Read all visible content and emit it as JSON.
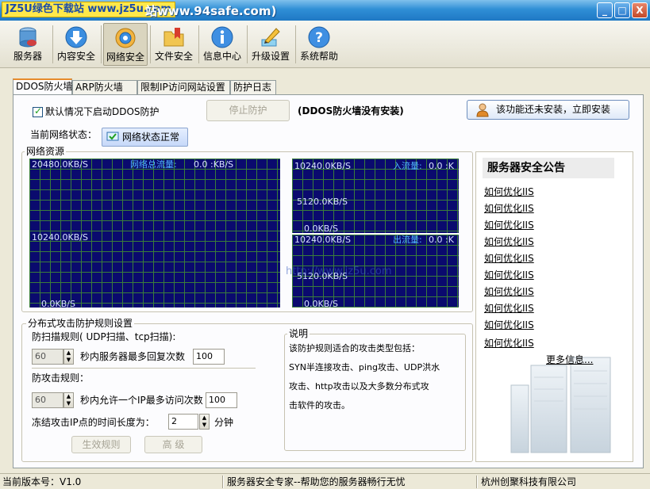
{
  "window": {
    "watermark": "JZ5U绿色下载站 www.jz5u.com",
    "title_fragment": "站www.94safe.com)",
    "controls": [
      "_",
      "□",
      "X"
    ]
  },
  "toolbar": {
    "items": [
      {
        "label": "服务器",
        "icon": "server-icon"
      },
      {
        "label": "内容安全",
        "icon": "download-arrow-icon"
      },
      {
        "label": "网络安全",
        "icon": "globe-gear-icon"
      },
      {
        "label": "文件安全",
        "icon": "folder-bookmark-icon"
      },
      {
        "label": "信息中心",
        "icon": "info-icon"
      },
      {
        "label": "升级设置",
        "icon": "pencil-icon"
      },
      {
        "label": "系统帮助",
        "icon": "help-icon"
      }
    ],
    "active_index": 2
  },
  "tabs": [
    {
      "label": "DDOS防火墙"
    },
    {
      "label": "ARP防火墙"
    },
    {
      "label": "限制IP访问网站设置"
    },
    {
      "label": "防护日志"
    }
  ],
  "ddos": {
    "checkbox_label": "默认情况下启动DDOS防护",
    "checkbox_checked": true,
    "stop_button": "停止防护",
    "not_installed_text": "(DDOS防火墙没有安装)",
    "install_button": "该功能还未安装，立即安装",
    "current_status_label": "当前网络状态：",
    "current_status_value": "网络状态正常"
  },
  "network": {
    "group_label": "网络资源",
    "total_graph": {
      "top": "20480.0KB/S",
      "mid": "10240.0KB/S",
      "bottom": "0.0KB/S",
      "caption": "网络总流量:",
      "value": "0.0 :KB/S"
    },
    "in_graph": {
      "top": "10240.0KB/S",
      "mid": "5120.0KB/S",
      "bottom": "0.0KB/S",
      "caption": "入流量:",
      "value": "0.0 :K"
    },
    "out_graph": {
      "top": "10240.0KB/S",
      "mid": "5120.0KB/S",
      "bottom": "0.0KB/S",
      "caption": "出流量:",
      "value": "0.0 :K"
    },
    "overlay_watermark": "http://www.jz5u.com"
  },
  "notice": {
    "title": "服务器安全公告",
    "links": [
      "如何优化IIS",
      "如何优化IIS",
      "如何优化IIS",
      "如何优化IIS",
      "如何优化IIS",
      "如何优化IIS",
      "如何优化IIS",
      "如何优化IIS",
      "如何优化IIS",
      "如何优化IIS"
    ],
    "more": "更多信息..."
  },
  "rules": {
    "group_label": "分布式攻击防护规则设置",
    "scan_rule_label": "防扫描规则( UDP扫描、tcp扫描):",
    "scan_seconds": "60",
    "scan_text": "秒内服务器最多回复次数",
    "scan_count": "100",
    "attack_rule_label": "防攻击规则：",
    "attack_seconds": "60",
    "attack_text": "秒内允许一个IP最多访问次数",
    "attack_count": "100",
    "freeze_label": "冻结攻击IP点的时间长度为：",
    "freeze_value": "2",
    "freeze_unit": "分钟",
    "apply_button": "生效规则",
    "advanced_button": "高 级"
  },
  "description": {
    "group_label": "说明",
    "lines": [
      "该防护规则适合的攻击类型包括：",
      "SYN半连接攻击、ping攻击、UDP洪水",
      "攻击、http攻击以及大多数分布式攻",
      "击软件的攻击。"
    ]
  },
  "statusbar": {
    "version": "当前版本号：V1.0",
    "slogan": "服务器安全专家--帮助您的服务器畅行无忧",
    "company": "杭州创聚科技有限公司"
  }
}
